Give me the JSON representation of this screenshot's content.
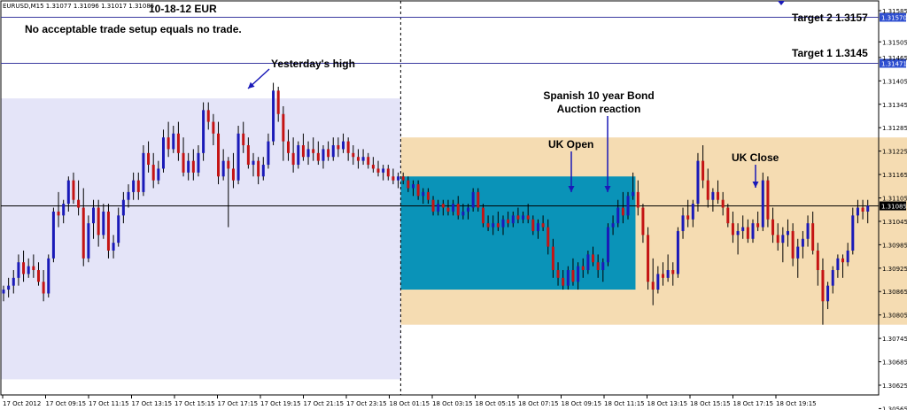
{
  "chart_data": {
    "type": "candlestick",
    "symbol_header": "EURUSD,M15  1.31077 1.31096 1.31017 1.31085",
    "title": "10-18-12 EUR",
    "note": "No acceptable trade setup equals no trade.",
    "ylim": [
      1.306,
      1.3161
    ],
    "y_ticks": [
      "1.31585",
      "1.31505",
      "1.31465",
      "1.31405",
      "1.31345",
      "1.31285",
      "1.31225",
      "1.31165",
      "1.31105",
      "1.31045",
      "1.30985",
      "1.30925",
      "1.30865",
      "1.30805",
      "1.30745",
      "1.30685",
      "1.30625",
      "1.30565"
    ],
    "x_ticks": [
      "17 Oct 2012",
      "17 Oct 09:15",
      "17 Oct 11:15",
      "17 Oct 13:15",
      "17 Oct 15:15",
      "17 Oct 17:15",
      "17 Oct 19:15",
      "17 Oct 21:15",
      "17 Oct 23:15",
      "18 Oct 01:15",
      "18 Oct 03:15",
      "18 Oct 05:15",
      "18 Oct 07:15",
      "18 Oct 09:15",
      "18 Oct 11:15",
      "18 Oct 13:15",
      "18 Oct 15:15",
      "18 Oct 17:15",
      "18 Oct 19:15"
    ],
    "levels": [
      {
        "label": "Target 2  1.3157",
        "price": 1.3157,
        "tag": "1.31570",
        "color": "#3a3aa0"
      },
      {
        "label": "Target 1  1.3145",
        "price": 1.3145,
        "tag": "1.31471",
        "color": "#3a3aa0"
      }
    ],
    "current_price": {
      "price": 1.31085,
      "tag": "1.31085"
    },
    "zones": [
      {
        "name": "yesterday-range",
        "from_bar": 0,
        "to_bar": 79,
        "high": 1.3136,
        "low": 1.3064,
        "color": "#e4e4f8"
      },
      {
        "name": "asian-range",
        "from_bar": 80,
        "to_bar": 126,
        "high": 1.3116,
        "low": 1.3087,
        "color": "#0a93b8"
      },
      {
        "name": "london-range",
        "from_bar": 80,
        "to_bar": 194,
        "high": 1.3126,
        "low": 1.3078,
        "color": "#f5dcb2"
      }
    ],
    "day_separator_bar": 80,
    "annotations": [
      {
        "text": "Yesterday's high",
        "arrow_bar": 54
      },
      {
        "text": "Spanish 10 year Bond\nAuction reaction",
        "arrow_bar": 137
      },
      {
        "text": "UK Open",
        "arrow_bar": 129
      },
      {
        "text": "UK Close",
        "arrow_bar": 170
      }
    ],
    "candles": [
      [
        1.3086,
        1.3088,
        1.3084,
        1.3087
      ],
      [
        1.3087,
        1.309,
        1.3085,
        1.3088
      ],
      [
        1.3088,
        1.3092,
        1.3086,
        1.309
      ],
      [
        1.309,
        1.3096,
        1.3088,
        1.3094
      ],
      [
        1.3094,
        1.3097,
        1.3089,
        1.3091
      ],
      [
        1.3091,
        1.3095,
        1.309,
        1.3093
      ],
      [
        1.3093,
        1.3096,
        1.309,
        1.3092
      ],
      [
        1.3092,
        1.3094,
        1.3088,
        1.3089
      ],
      [
        1.3089,
        1.3092,
        1.3084,
        1.3086
      ],
      [
        1.3086,
        1.3096,
        1.3085,
        1.3095
      ],
      [
        1.3095,
        1.3108,
        1.3094,
        1.3107
      ],
      [
        1.3107,
        1.3112,
        1.3103,
        1.3106
      ],
      [
        1.3106,
        1.311,
        1.3104,
        1.3109
      ],
      [
        1.3109,
        1.3116,
        1.3107,
        1.3115
      ],
      [
        1.3115,
        1.3117,
        1.3109,
        1.311
      ],
      [
        1.311,
        1.3115,
        1.3106,
        1.3108
      ],
      [
        1.3108,
        1.3113,
        1.3093,
        1.3095
      ],
      [
        1.3095,
        1.3106,
        1.3094,
        1.3104
      ],
      [
        1.3104,
        1.311,
        1.31,
        1.3108
      ],
      [
        1.3108,
        1.311,
        1.3098,
        1.3101
      ],
      [
        1.3101,
        1.3109,
        1.31,
        1.3107
      ],
      [
        1.3107,
        1.3109,
        1.3095,
        1.3097
      ],
      [
        1.3097,
        1.3101,
        1.3095,
        1.3099
      ],
      [
        1.3099,
        1.3108,
        1.3098,
        1.3106
      ],
      [
        1.3106,
        1.3112,
        1.3104,
        1.311
      ],
      [
        1.311,
        1.3114,
        1.3108,
        1.3112
      ],
      [
        1.3112,
        1.3117,
        1.311,
        1.3115
      ],
      [
        1.3115,
        1.3117,
        1.311,
        1.3112
      ],
      [
        1.3112,
        1.3124,
        1.3111,
        1.3122
      ],
      [
        1.3122,
        1.3125,
        1.3117,
        1.3119
      ],
      [
        1.3119,
        1.3122,
        1.3113,
        1.3115
      ],
      [
        1.3115,
        1.312,
        1.3114,
        1.3118
      ],
      [
        1.3118,
        1.3128,
        1.3117,
        1.3126
      ],
      [
        1.3126,
        1.313,
        1.3121,
        1.3123
      ],
      [
        1.3123,
        1.3129,
        1.3122,
        1.3127
      ],
      [
        1.3127,
        1.313,
        1.312,
        1.3122
      ],
      [
        1.3122,
        1.3126,
        1.3116,
        1.3117
      ],
      [
        1.3117,
        1.3122,
        1.3115,
        1.312
      ],
      [
        1.312,
        1.3123,
        1.3115,
        1.3117
      ],
      [
        1.3117,
        1.3124,
        1.3116,
        1.3122
      ],
      [
        1.3122,
        1.3135,
        1.312,
        1.3133
      ],
      [
        1.3133,
        1.3135,
        1.3128,
        1.313
      ],
      [
        1.313,
        1.3132,
        1.3124,
        1.3127
      ],
      [
        1.3127,
        1.313,
        1.3114,
        1.3116
      ],
      [
        1.3116,
        1.3123,
        1.3115,
        1.312
      ],
      [
        1.312,
        1.3121,
        1.3103,
        1.3118
      ],
      [
        1.3118,
        1.3122,
        1.3113,
        1.3115
      ],
      [
        1.3115,
        1.3129,
        1.3114,
        1.3127
      ],
      [
        1.3127,
        1.313,
        1.3122,
        1.3124
      ],
      [
        1.3124,
        1.3126,
        1.3118,
        1.3119
      ],
      [
        1.3119,
        1.3122,
        1.3116,
        1.312
      ],
      [
        1.312,
        1.3121,
        1.3114,
        1.3116
      ],
      [
        1.3116,
        1.3121,
        1.3115,
        1.3119
      ],
      [
        1.3119,
        1.3127,
        1.3118,
        1.3125
      ],
      [
        1.3125,
        1.314,
        1.3124,
        1.3138
      ],
      [
        1.3138,
        1.3139,
        1.313,
        1.3132
      ],
      [
        1.3132,
        1.3134,
        1.312,
        1.3125
      ],
      [
        1.3125,
        1.3128,
        1.312,
        1.3122
      ],
      [
        1.3122,
        1.3126,
        1.3117,
        1.3119
      ],
      [
        1.3119,
        1.3125,
        1.3118,
        1.3124
      ],
      [
        1.3124,
        1.3127,
        1.312,
        1.3121
      ],
      [
        1.3121,
        1.3125,
        1.3119,
        1.3123
      ],
      [
        1.3123,
        1.3126,
        1.312,
        1.3122
      ],
      [
        1.3122,
        1.3125,
        1.3119,
        1.312
      ],
      [
        1.312,
        1.3124,
        1.3118,
        1.3123
      ],
      [
        1.3123,
        1.3125,
        1.312,
        1.3121
      ],
      [
        1.3121,
        1.3126,
        1.312,
        1.3124
      ],
      [
        1.3124,
        1.3126,
        1.3121,
        1.3123
      ],
      [
        1.3123,
        1.3127,
        1.3122,
        1.3125
      ],
      [
        1.3125,
        1.3126,
        1.312,
        1.3122
      ],
      [
        1.3122,
        1.3124,
        1.3119,
        1.3121
      ],
      [
        1.3121,
        1.3123,
        1.3118,
        1.312
      ],
      [
        1.312,
        1.3123,
        1.3119,
        1.3121
      ],
      [
        1.3121,
        1.3122,
        1.3118,
        1.3119
      ],
      [
        1.3119,
        1.3121,
        1.3117,
        1.3118
      ],
      [
        1.3118,
        1.312,
        1.3116,
        1.3117
      ],
      [
        1.3117,
        1.3119,
        1.3115,
        1.3118
      ],
      [
        1.3118,
        1.3119,
        1.3115,
        1.3116
      ],
      [
        1.3116,
        1.3118,
        1.3114,
        1.3115
      ],
      [
        1.3115,
        1.3117,
        1.3113,
        1.3116
      ],
      [
        1.3116,
        1.3117,
        1.3114,
        1.3115
      ],
      [
        1.3115,
        1.3116,
        1.3112,
        1.3113
      ],
      [
        1.3113,
        1.3115,
        1.3111,
        1.3114
      ],
      [
        1.3114,
        1.3115,
        1.311,
        1.3111
      ],
      [
        1.3111,
        1.3113,
        1.3109,
        1.3112
      ],
      [
        1.3112,
        1.3113,
        1.3109,
        1.311
      ],
      [
        1.311,
        1.3111,
        1.3106,
        1.3107
      ],
      [
        1.3107,
        1.311,
        1.3106,
        1.3109
      ],
      [
        1.3109,
        1.311,
        1.3106,
        1.3108
      ],
      [
        1.3108,
        1.311,
        1.3106,
        1.3107
      ],
      [
        1.3107,
        1.311,
        1.3106,
        1.3109
      ],
      [
        1.3109,
        1.3111,
        1.3105,
        1.3106
      ],
      [
        1.3106,
        1.3109,
        1.3105,
        1.3107
      ],
      [
        1.3107,
        1.3109,
        1.3105,
        1.3108
      ],
      [
        1.3108,
        1.3113,
        1.3107,
        1.3112
      ],
      [
        1.3112,
        1.3113,
        1.3107,
        1.3108
      ],
      [
        1.3108,
        1.3109,
        1.3103,
        1.3104
      ],
      [
        1.3104,
        1.3106,
        1.3102,
        1.3103
      ],
      [
        1.3103,
        1.3106,
        1.3101,
        1.3104
      ],
      [
        1.3104,
        1.3107,
        1.3102,
        1.3103
      ],
      [
        1.3103,
        1.3106,
        1.3101,
        1.3105
      ],
      [
        1.3105,
        1.3107,
        1.3103,
        1.3104
      ],
      [
        1.3104,
        1.3107,
        1.3103,
        1.3106
      ],
      [
        1.3106,
        1.3108,
        1.3104,
        1.3105
      ],
      [
        1.3105,
        1.3107,
        1.3104,
        1.3106
      ],
      [
        1.3106,
        1.3109,
        1.3104,
        1.3105
      ],
      [
        1.3105,
        1.3106,
        1.3101,
        1.3102
      ],
      [
        1.3102,
        1.3105,
        1.31,
        1.3104
      ],
      [
        1.3104,
        1.3106,
        1.3102,
        1.3103
      ],
      [
        1.3103,
        1.3105,
        1.3096,
        1.3098
      ],
      [
        1.3098,
        1.31,
        1.309,
        1.3092
      ],
      [
        1.3092,
        1.3094,
        1.3088,
        1.309
      ],
      [
        1.309,
        1.3092,
        1.3087,
        1.3088
      ],
      [
        1.3088,
        1.3093,
        1.3087,
        1.3092
      ],
      [
        1.3092,
        1.3095,
        1.3088,
        1.3089
      ],
      [
        1.3089,
        1.3094,
        1.3087,
        1.3093
      ],
      [
        1.3093,
        1.3095,
        1.309,
        1.3092
      ],
      [
        1.3092,
        1.3097,
        1.3091,
        1.3096
      ],
      [
        1.3096,
        1.3098,
        1.3093,
        1.3094
      ],
      [
        1.3094,
        1.3096,
        1.309,
        1.3092
      ],
      [
        1.3092,
        1.3095,
        1.3089,
        1.3094
      ],
      [
        1.3094,
        1.3104,
        1.3093,
        1.3103
      ],
      [
        1.3103,
        1.3106,
        1.3101,
        1.3104
      ],
      [
        1.3104,
        1.311,
        1.3103,
        1.3108
      ],
      [
        1.3108,
        1.3112,
        1.3104,
        1.3106
      ],
      [
        1.3106,
        1.3112,
        1.3105,
        1.3111
      ],
      [
        1.3111,
        1.3117,
        1.311,
        1.3112
      ],
      [
        1.3112,
        1.3115,
        1.3106,
        1.3108
      ],
      [
        1.3108,
        1.3109,
        1.3099,
        1.3101
      ],
      [
        1.3101,
        1.3103,
        1.3087,
        1.3089
      ],
      [
        1.3089,
        1.3095,
        1.3083,
        1.3087
      ],
      [
        1.3087,
        1.3093,
        1.3086,
        1.3091
      ],
      [
        1.3091,
        1.3094,
        1.3088,
        1.309
      ],
      [
        1.309,
        1.3096,
        1.3089,
        1.3092
      ],
      [
        1.3092,
        1.3094,
        1.3088,
        1.3091
      ],
      [
        1.3091,
        1.3103,
        1.309,
        1.3102
      ],
      [
        1.3102,
        1.3108,
        1.31,
        1.3106
      ],
      [
        1.3106,
        1.311,
        1.3103,
        1.3105
      ],
      [
        1.3105,
        1.311,
        1.3103,
        1.3109
      ],
      [
        1.3109,
        1.3122,
        1.3107,
        1.312
      ],
      [
        1.312,
        1.3124,
        1.3113,
        1.3115
      ],
      [
        1.3115,
        1.3118,
        1.3108,
        1.311
      ],
      [
        1.311,
        1.3113,
        1.3107,
        1.3112
      ],
      [
        1.3112,
        1.3115,
        1.3109,
        1.311
      ],
      [
        1.311,
        1.3112,
        1.3106,
        1.3108
      ],
      [
        1.3108,
        1.3109,
        1.3103,
        1.3104
      ],
      [
        1.3104,
        1.3107,
        1.3099,
        1.3101
      ],
      [
        1.3101,
        1.3104,
        1.3096,
        1.3102
      ],
      [
        1.3102,
        1.3106,
        1.31,
        1.3103
      ],
      [
        1.3103,
        1.3105,
        1.3099,
        1.31
      ],
      [
        1.31,
        1.3105,
        1.3099,
        1.3104
      ],
      [
        1.3104,
        1.3107,
        1.3102,
        1.3103
      ],
      [
        1.3103,
        1.3117,
        1.3102,
        1.3115
      ],
      [
        1.3115,
        1.3116,
        1.3103,
        1.3105
      ],
      [
        1.3105,
        1.3108,
        1.3099,
        1.3101
      ],
      [
        1.3101,
        1.3104,
        1.3097,
        1.3099
      ],
      [
        1.3099,
        1.3103,
        1.3094,
        1.3101
      ],
      [
        1.3101,
        1.3105,
        1.3098,
        1.3102
      ],
      [
        1.3102,
        1.3104,
        1.3093,
        1.3095
      ],
      [
        1.3095,
        1.31,
        1.309,
        1.3098
      ],
      [
        1.3098,
        1.3102,
        1.3095,
        1.31
      ],
      [
        1.31,
        1.3106,
        1.3098,
        1.3104
      ],
      [
        1.3104,
        1.3107,
        1.3096,
        1.3097
      ],
      [
        1.3097,
        1.3099,
        1.3088,
        1.3092
      ],
      [
        1.3092,
        1.3095,
        1.3078,
        1.3084
      ],
      [
        1.3084,
        1.3089,
        1.3082,
        1.3088
      ],
      [
        1.3088,
        1.3093,
        1.3086,
        1.3092
      ],
      [
        1.3092,
        1.3096,
        1.309,
        1.3095
      ],
      [
        1.3095,
        1.3096,
        1.309,
        1.3094
      ],
      [
        1.3094,
        1.3099,
        1.3093,
        1.3097
      ],
      [
        1.3097,
        1.3108,
        1.3096,
        1.3106
      ],
      [
        1.3106,
        1.311,
        1.3104,
        1.3108
      ],
      [
        1.3108,
        1.311,
        1.3105,
        1.3107
      ],
      [
        1.3107,
        1.311,
        1.3104,
        1.31085
      ]
    ]
  }
}
